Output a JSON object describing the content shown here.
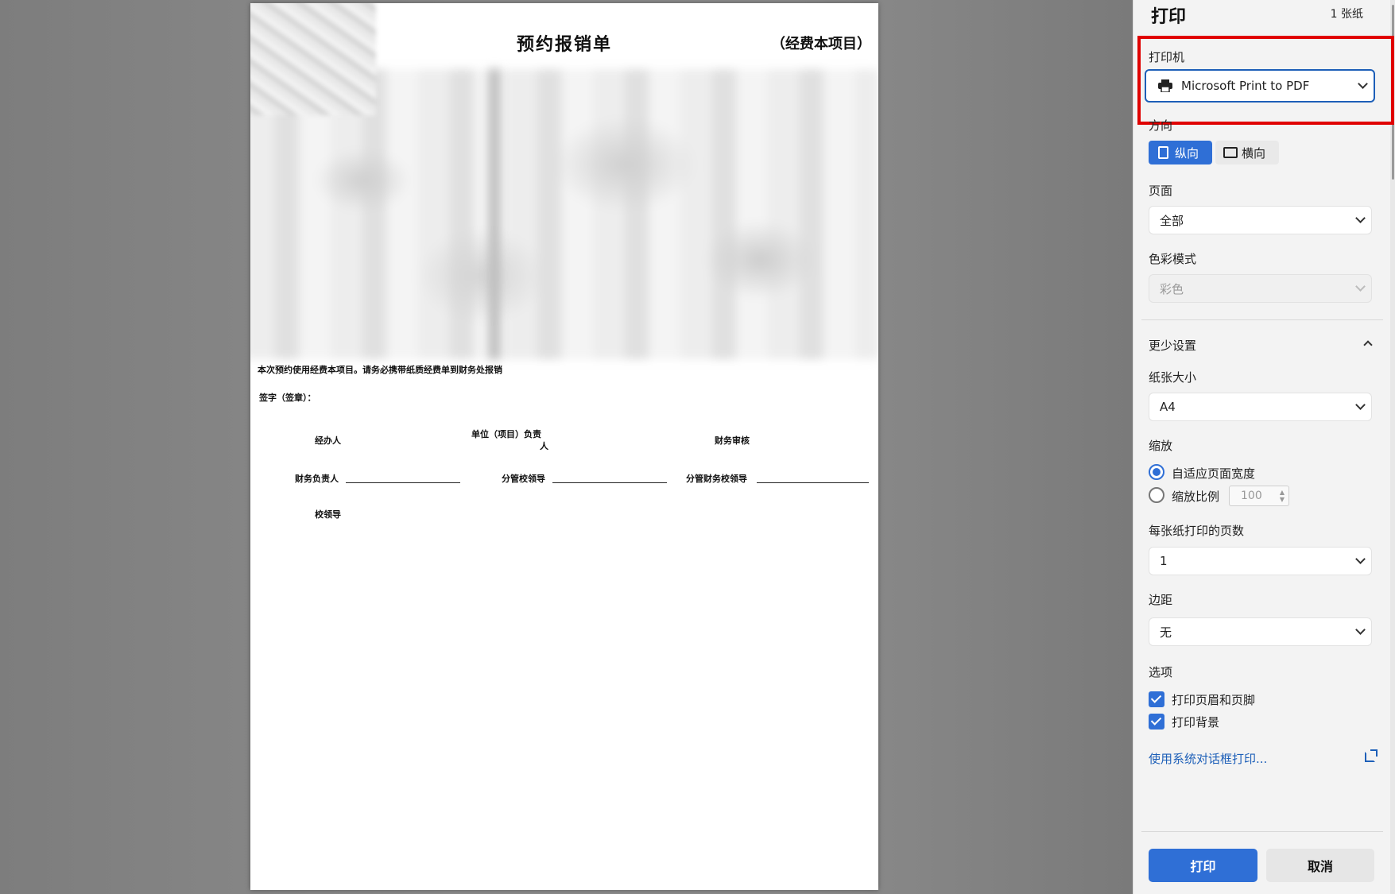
{
  "document": {
    "title": "预约报销单",
    "subtitle": "（经费本项目）",
    "note": "本次预约使用经费本项目。请务必携带纸质经费单到财务处报销",
    "signature_label": "签字（签章）：",
    "fields": {
      "handler": "经办人",
      "unit_head_line1": "单位（项目）负责",
      "unit_head_line2": "人",
      "finance_review": "财务审核",
      "finance_head": "财务负责人",
      "supervising_leader": "分管校领导",
      "finance_supervising_leader": "分管财务校领导",
      "school_leader": "校领导"
    }
  },
  "print_panel": {
    "title": "打印",
    "sheet_count": "1 张纸",
    "printer": {
      "label": "打印机",
      "value": "Microsoft Print to PDF",
      "icon": "printer-icon"
    },
    "orientation": {
      "label": "方向",
      "portrait": "纵向",
      "landscape": "横向",
      "selected": "portrait"
    },
    "pages": {
      "label": "页面",
      "value": "全部"
    },
    "color_mode": {
      "label": "色彩模式",
      "value": "彩色",
      "disabled": true
    },
    "less_settings": "更少设置",
    "paper_size": {
      "label": "纸张大小",
      "value": "A4"
    },
    "scale": {
      "label": "缩放",
      "fit_width": "自适应页面宽度",
      "custom": "缩放比例",
      "custom_value": "100",
      "selected": "fit_width"
    },
    "pages_per_sheet": {
      "label": "每张纸打印的页数",
      "value": "1"
    },
    "margins": {
      "label": "边距",
      "value": "无"
    },
    "options": {
      "label": "选项",
      "headers_footers": "打印页眉和页脚",
      "background": "打印背景",
      "headers_footers_checked": true,
      "background_checked": true
    },
    "system_dialog_link": "使用系统对话框打印...",
    "print_button": "打印",
    "cancel_button": "取消"
  },
  "colors": {
    "accent": "#2f6fd6",
    "highlight": "#e00000",
    "link": "#1d5fb8"
  }
}
